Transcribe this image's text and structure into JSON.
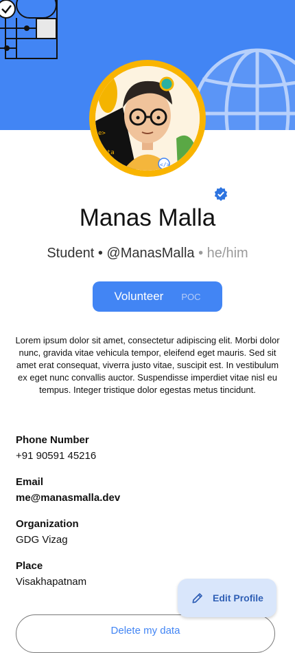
{
  "profile": {
    "name": "Manas Malla",
    "role": "Student",
    "handle": "@ManasMalla",
    "pronouns": "he/him",
    "badge_role": "Volunteer",
    "badge_extra": "POC",
    "bio": "Lorem ipsum dolor sit amet, consectetur adipiscing elit. Morbi dolor nunc, gravida vitae vehicula tempor, eleifend eget mauris. Sed sit amet erat consequat, viverra justo vitae, suscipit est. In vestibulum ex eget nunc convallis auctor. Suspendisse imperdiet vitae nisl eu tempus. Integer tristique dolor egestas metus tincidunt."
  },
  "fields": {
    "phone_label": "Phone Number",
    "phone_value": "+91 90591 45216",
    "email_label": "Email",
    "email_value": "me@manasmalla.dev",
    "org_label": "Organization",
    "org_value": "GDG Vizag",
    "place_label": "Place",
    "place_value": "Visakhapatnam"
  },
  "actions": {
    "edit_profile": "Edit Profile",
    "delete_data": "Delete my data"
  },
  "icons": {
    "verified": "verified-badge-icon",
    "edit": "pencil-icon"
  },
  "colors": {
    "brand_blue": "#4285f4",
    "avatar_ring": "#f9b400",
    "fab_bg": "#d9e6fb"
  }
}
